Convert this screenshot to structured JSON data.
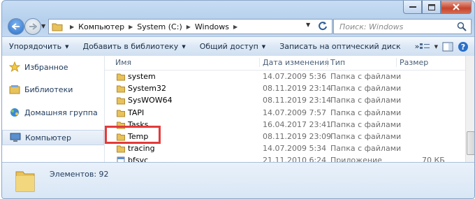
{
  "address": {
    "crumbs": [
      "Компьютер",
      "System (C:)",
      "Windows"
    ]
  },
  "search": {
    "placeholder": "Поиск: Windows"
  },
  "toolbar": {
    "organize": "Упорядочить",
    "add_library": "Добавить в библиотеку",
    "share": "Общий доступ",
    "burn": "Записать на оптический диск",
    "more": "»"
  },
  "sidebar": {
    "items": [
      {
        "label": "Избранное",
        "icon": "star-icon"
      },
      {
        "label": "Библиотеки",
        "icon": "library-icon"
      },
      {
        "label": "Домашняя группа",
        "icon": "homegroup-icon"
      },
      {
        "label": "Компьютер",
        "icon": "computer-icon"
      }
    ]
  },
  "columns": {
    "name": "Имя",
    "date": "Дата изменения",
    "type": "Тип",
    "size": "Размер"
  },
  "files": [
    {
      "name": "system",
      "date": "14.07.2009 5:36",
      "type": "Папка с файлами",
      "size": ""
    },
    {
      "name": "System32",
      "date": "08.11.2019 23:14",
      "type": "Папка с файлами",
      "size": ""
    },
    {
      "name": "SysWOW64",
      "date": "08.11.2019 23:14",
      "type": "Папка с файлами",
      "size": ""
    },
    {
      "name": "TAPI",
      "date": "14.07.2009 7:57",
      "type": "Папка с файлами",
      "size": ""
    },
    {
      "name": "Tasks",
      "date": "16.04.2017 23:41",
      "type": "Папка с файлами",
      "size": ""
    },
    {
      "name": "Temp",
      "date": "08.11.2019 23:09",
      "type": "Папка с файлами",
      "size": ""
    },
    {
      "name": "tracing",
      "date": "14.07.2009 5:34",
      "type": "Папка с файлами",
      "size": ""
    },
    {
      "name": "bfsvc",
      "date": "21.11.2010 6:24",
      "type": "Приложение",
      "size": "70 КБ"
    }
  ],
  "status": {
    "items_text": "Элементов: 92"
  },
  "colors": {
    "highlight": "#e43a3a",
    "folder": "#e8c25a"
  }
}
